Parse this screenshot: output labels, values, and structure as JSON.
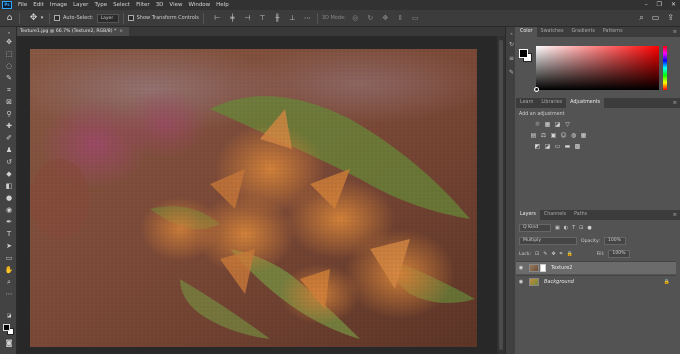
{
  "menubar": {
    "logo": "Ps",
    "items": [
      "File",
      "Edit",
      "Image",
      "Layer",
      "Type",
      "Select",
      "Filter",
      "3D",
      "View",
      "Window",
      "Help"
    ],
    "window_controls": [
      "–",
      "❐",
      "✕"
    ]
  },
  "options": {
    "auto_select_label": "Auto-Select:",
    "auto_select_value": "Layer",
    "transform_label": "Show Transform Controls",
    "mode_3d_label": "3D Mode:"
  },
  "document": {
    "tab_title": "Texture1.jpg @ 66.7% (Texture2, RGB/8) *",
    "close": "×"
  },
  "color_panel": {
    "tabs": [
      "Color",
      "Swatches",
      "Gradients",
      "Patterns"
    ],
    "accent": "#31a8ff"
  },
  "adjust_panel": {
    "tabs": [
      "Learn",
      "Libraries",
      "Adjustments"
    ],
    "add_label": "Add an adjustment",
    "row1_icons": [
      "☼",
      "▦",
      "◪",
      "▽"
    ],
    "row2_icons": [
      "▤",
      "⚖",
      "▣",
      "☺",
      "◍",
      "▦"
    ],
    "row3_icons": [
      "◩",
      "◪",
      "▭",
      "▬",
      "▩"
    ]
  },
  "layers_panel": {
    "tabs": [
      "Layers",
      "Channels",
      "Paths"
    ],
    "filter_label": "Q Kind",
    "filter_icons": [
      "▣",
      "◐",
      "T",
      "⊡",
      "●"
    ],
    "blend_mode": "Multiply",
    "opacity_label": "Opacity:",
    "opacity_value": "100%",
    "lock_label": "Lock:",
    "lock_icons": [
      "⊡",
      "✎",
      "✥",
      "⌗",
      "🔒"
    ],
    "fill_label": "Fill:",
    "fill_value": "100%",
    "layers": [
      {
        "name": "Texture2",
        "selected": true,
        "locked": false
      },
      {
        "name": "Background",
        "selected": false,
        "locked": true
      }
    ]
  }
}
